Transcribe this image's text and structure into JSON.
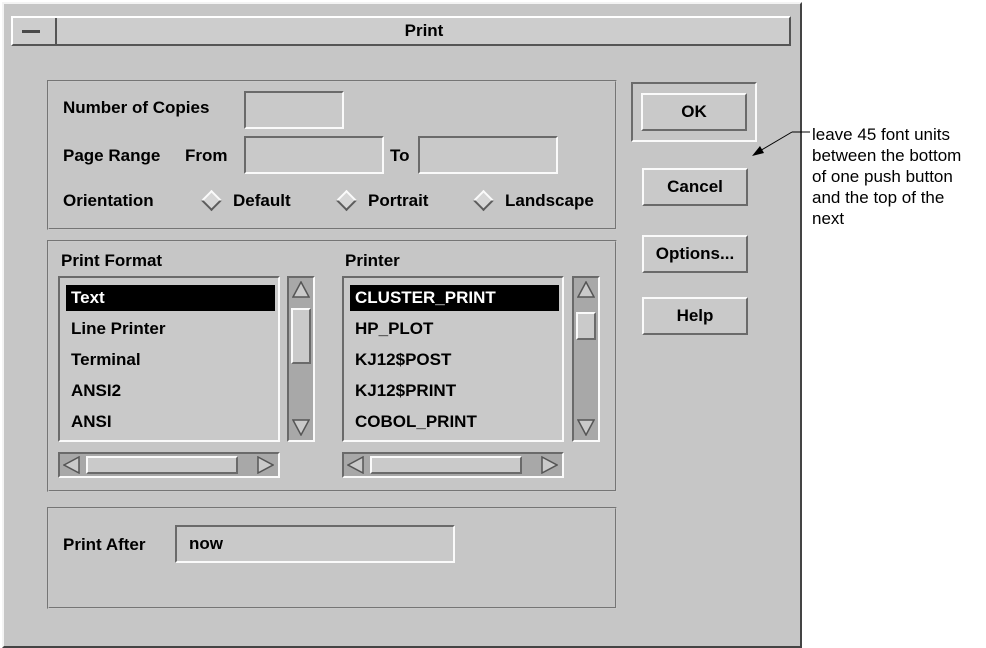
{
  "window": {
    "title": "Print"
  },
  "print_options": {
    "copies_label": "Number of Copies",
    "copies_value": "",
    "page_range_label": "Page Range",
    "from_label": "From",
    "from_value": "",
    "to_label": "To",
    "to_value": "",
    "orientation_label": "Orientation",
    "orientation_options": [
      "Default",
      "Portrait",
      "Landscape"
    ]
  },
  "print_format": {
    "label": "Print Format",
    "items": [
      "Text",
      "Line Printer",
      "Terminal",
      "ANSI2",
      "ANSI"
    ],
    "selected": "Text"
  },
  "printer": {
    "label": "Printer",
    "items": [
      "CLUSTER_PRINT",
      "HP_PLOT",
      "KJ12$POST",
      "KJ12$PRINT",
      "COBOL_PRINT"
    ],
    "selected": "CLUSTER_PRINT"
  },
  "print_after": {
    "label": "Print After",
    "value": "now"
  },
  "buttons": {
    "ok": "OK",
    "cancel": "Cancel",
    "options": "Options...",
    "help": "Help"
  },
  "annotation": {
    "lines": [
      "leave 45 font units",
      "between the bottom",
      "of one push button",
      "and the top of the",
      "next"
    ]
  }
}
